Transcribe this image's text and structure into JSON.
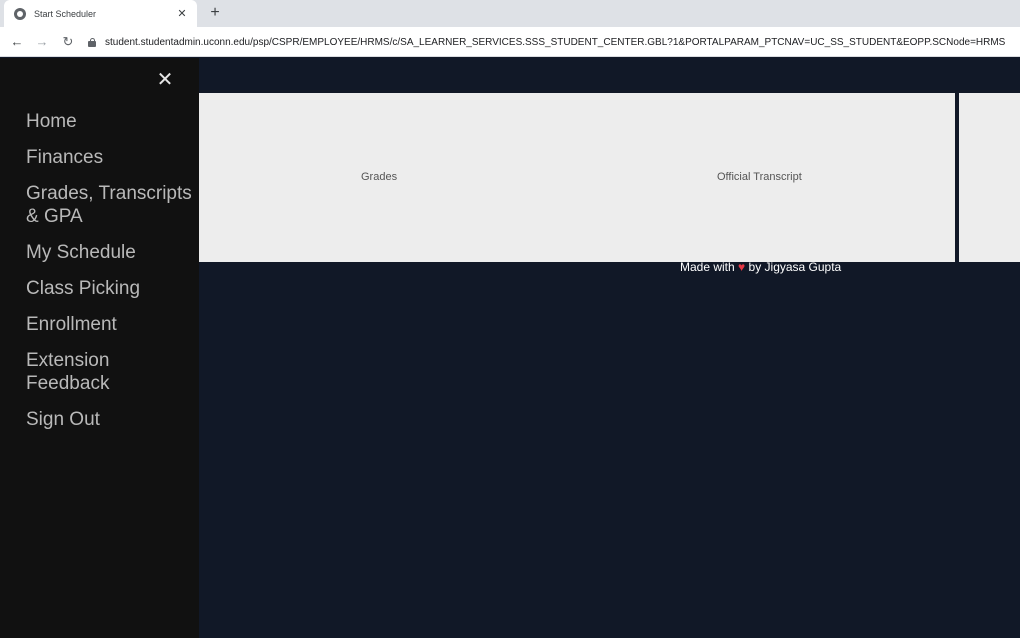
{
  "browser": {
    "tab_title": "Start Scheduler",
    "tab_close": "✕",
    "new_tab": "+",
    "url": "student.studentadmin.uconn.edu/psp/CSPR/EMPLOYEE/HRMS/c/SA_LEARNER_SERVICES.SSS_STUDENT_CENTER.GBL?1&PORTALPARAM_PTCNAV=UC_SS_STUDENT&EOPP.SCNode=HRMS"
  },
  "sidebar": {
    "close_glyph": "✕",
    "items": [
      {
        "label": "Home"
      },
      {
        "label": "Finances"
      },
      {
        "label": "Grades, Transcripts & GPA"
      },
      {
        "label": "My Schedule"
      },
      {
        "label": "Class Picking"
      },
      {
        "label": "Enrollment"
      },
      {
        "label": "Extension Feedback"
      },
      {
        "label": "Sign Out"
      }
    ]
  },
  "main": {
    "cards": [
      {
        "label": "Grades"
      },
      {
        "label": "Official Transcript"
      }
    ],
    "footer": {
      "prefix": "Made with",
      "heart": "♥",
      "suffix": "by Jigyasa Gupta"
    }
  },
  "colors": {
    "page_background": "#111827",
    "sidebar_background": "#111111",
    "card_background": "#ededed",
    "heart": "#e63946"
  }
}
